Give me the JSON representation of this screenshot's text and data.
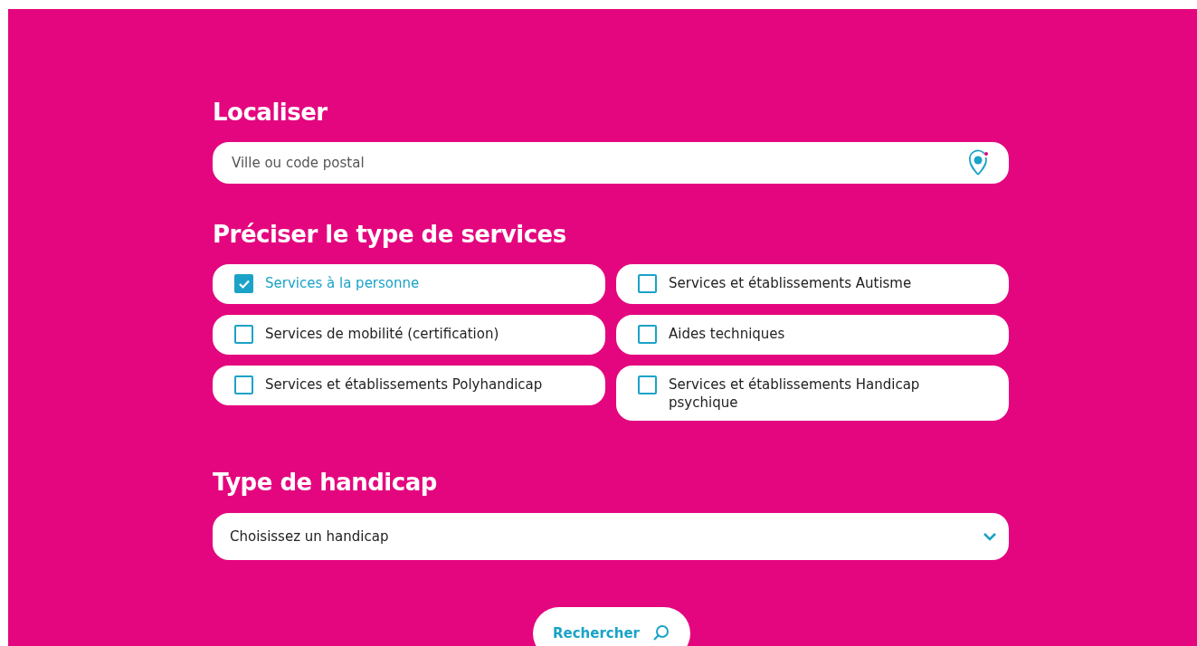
{
  "location": {
    "title": "Localiser",
    "field": {
      "placeholder": "Ville ou code postal"
    }
  },
  "services": {
    "title": "Préciser le type de services",
    "options": [
      {
        "label": "Services à la personne",
        "checked": true
      },
      {
        "label": "Services et établissements Autisme",
        "checked": false
      },
      {
        "label": "Services de mobilité (certification)",
        "checked": false
      },
      {
        "label": "Aides techniques",
        "checked": false
      },
      {
        "label": "Services et établissements Polyhandicap",
        "checked": false
      },
      {
        "label": "Services et établissements Handicap psychique",
        "checked": false
      }
    ]
  },
  "handicap": {
    "title": "Type de handicap",
    "select": {
      "value": "Choisissez un handicap"
    }
  },
  "search_button": {
    "label": "Rechercher"
  }
}
